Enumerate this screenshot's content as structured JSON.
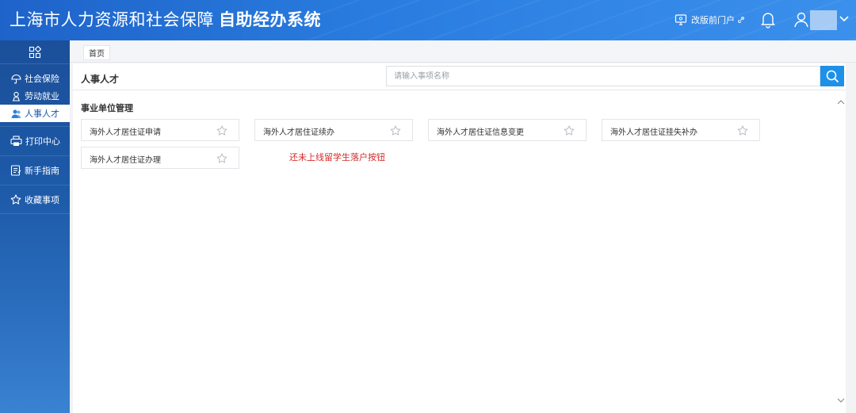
{
  "header": {
    "title_main": "上海市人力资源和社会保障",
    "title_strong": "自助经办系统",
    "portal_link": "改版前门户",
    "colors": {
      "bar": "#2a7de0",
      "accent": "#1e90e8"
    }
  },
  "sidebar": {
    "items": [
      {
        "label": "社会保险",
        "icon": "umbrella-icon"
      },
      {
        "label": "劳动就业",
        "icon": "worker-icon"
      },
      {
        "label": "人事人才",
        "icon": "users-icon",
        "active": true
      }
    ],
    "blocks": [
      {
        "label": "打印中心",
        "icon": "printer-icon"
      },
      {
        "label": "新手指南",
        "icon": "guide-icon"
      },
      {
        "label": "收藏事项",
        "icon": "star-icon"
      }
    ]
  },
  "breadcrumb": {
    "home": "首页"
  },
  "main": {
    "section_title": "人事人才",
    "search_placeholder": "请输入事项名称",
    "group_title": "事业单位管理",
    "cards": [
      "海外人才居住证申请",
      "海外人才居住证续办",
      "海外人才居住证信息变更",
      "海外人才居住证挂失补办",
      "海外人才居住证办理"
    ],
    "note": "还未上线留学生落户按钮",
    "note_color": "#d42a2a"
  }
}
